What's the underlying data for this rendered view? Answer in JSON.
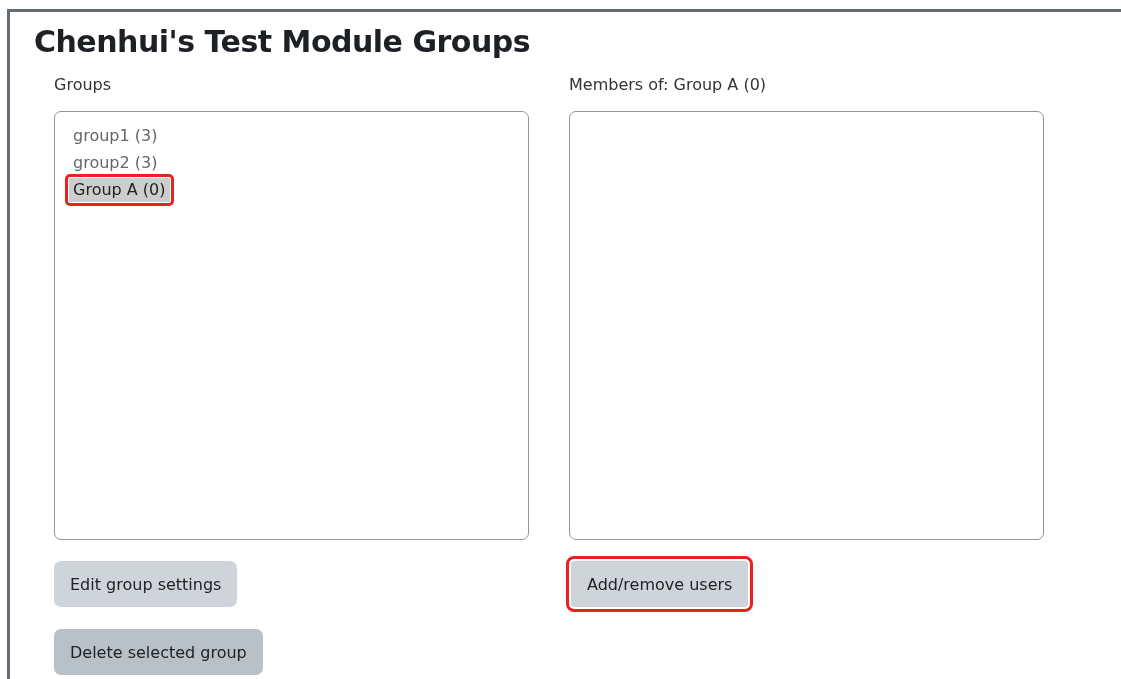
{
  "page": {
    "title": "Chenhui's Test Module Groups"
  },
  "groups_panel": {
    "label": "Groups",
    "items": [
      {
        "label": "group1 (3)",
        "selected": false,
        "highlighted": false
      },
      {
        "label": "group2 (3)",
        "selected": false,
        "highlighted": false
      },
      {
        "label": "Group A (0)",
        "selected": true,
        "highlighted": true
      }
    ],
    "buttons": [
      {
        "label": "Edit group settings",
        "active": false,
        "highlighted": false
      },
      {
        "label": "Delete selected group",
        "active": true,
        "highlighted": false
      }
    ]
  },
  "members_panel": {
    "label": "Members of: Group A (0)",
    "buttons": [
      {
        "label": "Add/remove users",
        "active": false,
        "highlighted": true
      }
    ]
  }
}
